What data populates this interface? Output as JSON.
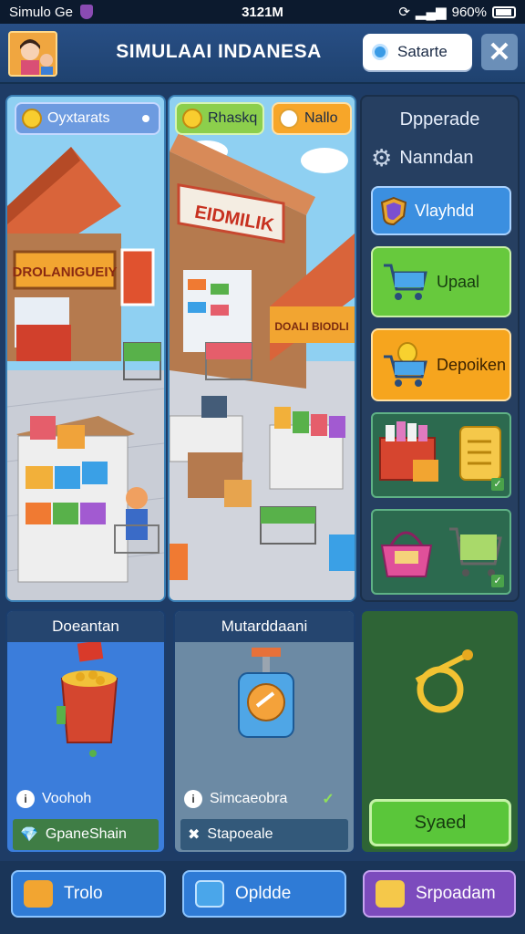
{
  "status_bar": {
    "carrier": "Simulo Ge",
    "time": "3121M",
    "battery": "960%"
  },
  "header": {
    "title": "SIMULAAI INDANESA",
    "status_button": "Satarte",
    "close_symbol": "✕"
  },
  "shop_left": {
    "pill_label": "Oyxtarats",
    "sign_text": "DROLANIGUEIY"
  },
  "shop_mid": {
    "pill_green_label": "Rhaskq",
    "pill_orange_label": "Nallo",
    "sign_text": "EIDMILIK",
    "awning_text": "DOALI BIODLI"
  },
  "right_panel": {
    "title": "Dpperade",
    "setting_label": "Nanndan",
    "blue_button": "Vlayhdd",
    "green_button": "Upaal",
    "orange_button": "Depoiken"
  },
  "cards": {
    "card1": {
      "header": "Doeantan",
      "row_label": "Voohoh",
      "strip_label": "GpaneShain"
    },
    "card2": {
      "header": "Mutarddaani",
      "row_label": "Simcaeobra",
      "strip_label": "Stapoeale"
    },
    "card3": {
      "button": "Syaed"
    }
  },
  "bottom_nav": {
    "btn1": "Trolo",
    "btn2": "Opldde",
    "btn3": "Srpoadam"
  },
  "colors": {
    "background": "#1e3c66",
    "accent_green": "#5ac63a",
    "accent_orange": "#f6a51e",
    "accent_blue": "#2f7bd6",
    "accent_purple": "#7c4bbd"
  }
}
